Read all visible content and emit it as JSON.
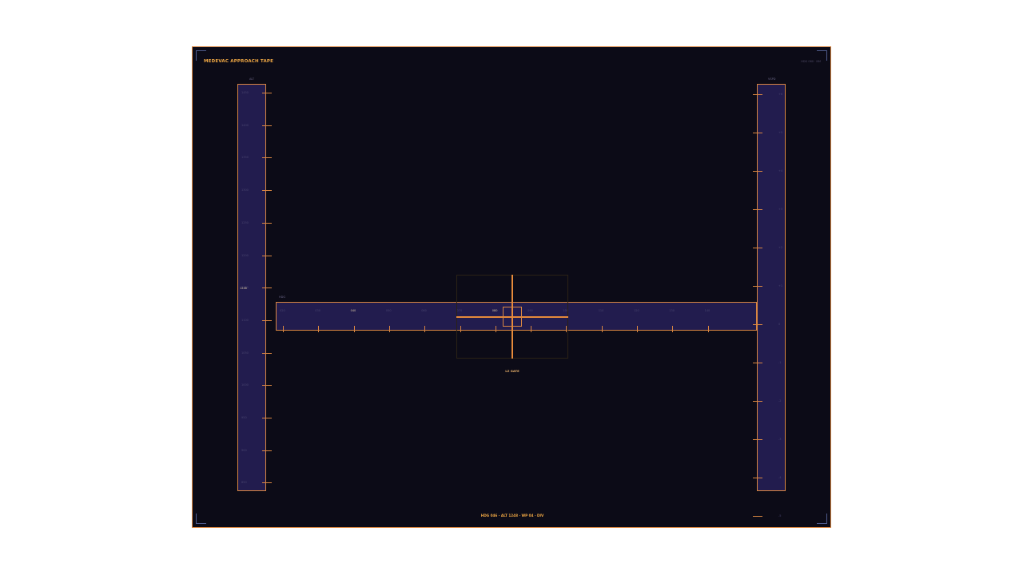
{
  "app": {
    "title": "MEDEVAC APPROACH TAPE",
    "window_meta": "HDG 060 · NM"
  },
  "colors": {
    "accent": "#d98642",
    "accent_bright": "#f0a844",
    "tape_fill": "#221c4e",
    "background": "#0c0b17",
    "corner": "#4e5a8a"
  },
  "alt_tape": {
    "label": "ALT",
    "current": "1248",
    "scale": [
      "1450",
      "1400",
      "1350",
      "1300",
      "1250",
      "1200",
      "1150",
      "1100",
      "1050",
      "1000",
      "950",
      "900",
      "850"
    ]
  },
  "vsi_tape": {
    "label": "VSPD",
    "scale": [
      "+6",
      "+5",
      "+4",
      "+3",
      "+2",
      "+1",
      "0",
      "-1",
      "-2",
      "-3",
      "-4",
      "-5"
    ]
  },
  "hdg_tape": {
    "label": "HDG",
    "scale": [
      "020",
      "030",
      "040",
      "050",
      "060",
      "070",
      "080",
      "090",
      "100",
      "110",
      "120",
      "130",
      "140"
    ],
    "highlight": [
      "040",
      "080"
    ]
  },
  "target": {
    "label": "LZ GATE"
  },
  "status_bar": {
    "text": "HDG 046 · ALT 1248 · WP 04 · DIV"
  }
}
